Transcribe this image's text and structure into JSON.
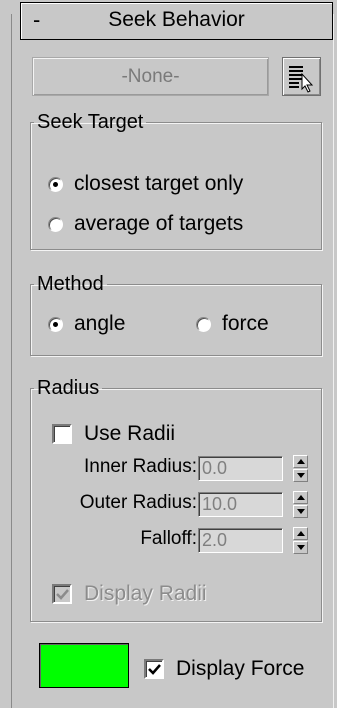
{
  "rollout": {
    "collapse_sign": "-",
    "title": "Seek Behavior"
  },
  "target_button": {
    "label": "-None-"
  },
  "list_button": {
    "icon": "select-from-list-icon"
  },
  "seek_target": {
    "title": "Seek Target",
    "options": [
      {
        "label": "closest target only",
        "checked": true
      },
      {
        "label": "average of targets",
        "checked": false
      }
    ]
  },
  "method": {
    "title": "Method",
    "options": [
      {
        "label": "angle",
        "checked": true
      },
      {
        "label": "force",
        "checked": false
      }
    ]
  },
  "radius": {
    "title": "Radius",
    "use_radii": {
      "label": "Use Radii",
      "checked": false
    },
    "inner": {
      "label": "Inner Radius:",
      "value": "0.0"
    },
    "outer": {
      "label": "Outer Radius:",
      "value": "10.0"
    },
    "falloff": {
      "label": "Falloff:",
      "value": "2.0"
    },
    "display_radii": {
      "label": "Display Radii",
      "checked": true,
      "enabled": false
    }
  },
  "display_force": {
    "color": "#00ff00",
    "label": "Display Force",
    "checked": true
  }
}
